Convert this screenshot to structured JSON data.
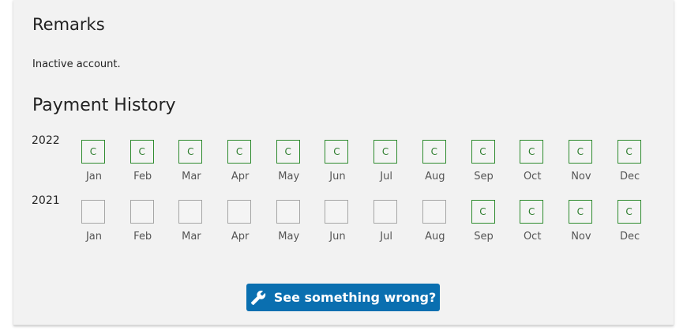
{
  "remarks": {
    "title": "Remarks",
    "text": "Inactive account."
  },
  "payment_history": {
    "title": "Payment History",
    "status_color": "#2e8b2e",
    "years": [
      {
        "year": "2022",
        "months": [
          {
            "label": "Jan",
            "status": "C"
          },
          {
            "label": "Feb",
            "status": "C"
          },
          {
            "label": "Mar",
            "status": "C"
          },
          {
            "label": "Apr",
            "status": "C"
          },
          {
            "label": "May",
            "status": "C"
          },
          {
            "label": "Jun",
            "status": "C"
          },
          {
            "label": "Jul",
            "status": "C"
          },
          {
            "label": "Aug",
            "status": "C"
          },
          {
            "label": "Sep",
            "status": "C"
          },
          {
            "label": "Oct",
            "status": "C"
          },
          {
            "label": "Nov",
            "status": "C"
          },
          {
            "label": "Dec",
            "status": "C"
          }
        ]
      },
      {
        "year": "2021",
        "months": [
          {
            "label": "Jan",
            "status": ""
          },
          {
            "label": "Feb",
            "status": ""
          },
          {
            "label": "Mar",
            "status": ""
          },
          {
            "label": "Apr",
            "status": ""
          },
          {
            "label": "May",
            "status": ""
          },
          {
            "label": "Jun",
            "status": ""
          },
          {
            "label": "Jul",
            "status": ""
          },
          {
            "label": "Aug",
            "status": ""
          },
          {
            "label": "Sep",
            "status": "C"
          },
          {
            "label": "Oct",
            "status": "C"
          },
          {
            "label": "Nov",
            "status": "C"
          },
          {
            "label": "Dec",
            "status": "C"
          }
        ]
      }
    ]
  },
  "report_button": {
    "label": "See something wrong?",
    "icon": "wrench-icon",
    "color": "#0a6fb0"
  }
}
